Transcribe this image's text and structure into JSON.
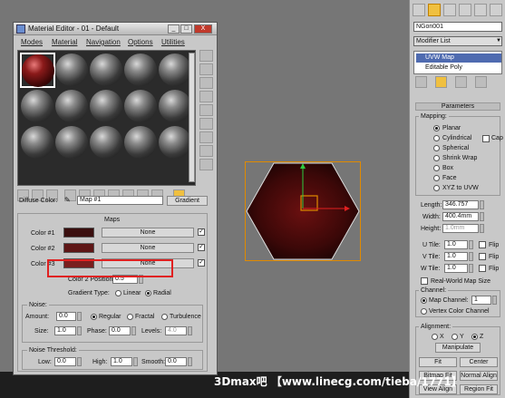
{
  "material_editor": {
    "title": "Material Editor - 01 - Default",
    "window_buttons": [
      "_",
      "□",
      "X"
    ],
    "menu": [
      "Modes",
      "Material",
      "Navigation",
      "Options",
      "Utilities"
    ],
    "diffuse_label": "Diffuse Color:",
    "map_name": "Map #1",
    "map_type_button": "Gradient",
    "maps_rollout_title": "Maps",
    "colors": [
      {
        "label": "Color #1",
        "swatch": "#3a0e0e",
        "map": "None"
      },
      {
        "label": "Color #2",
        "swatch": "#5e1616",
        "map": "None"
      },
      {
        "label": "Color #3",
        "swatch": "#7a1e1e",
        "map": "None"
      }
    ],
    "color2_position_label": "Color 2 Position:",
    "color2_position_value": "0.5",
    "gradient_type_label": "Gradient Type:",
    "gradient_type_options": [
      "Linear",
      "Radial"
    ],
    "gradient_type_selected": "Radial",
    "noise": {
      "title": "Noise:",
      "amount_label": "Amount:",
      "amount_value": "0.0",
      "types": [
        "Regular",
        "Fractal",
        "Turbulence"
      ],
      "selected_type": "Regular",
      "size_label": "Size:",
      "size_value": "1.0",
      "phase_label": "Phase:",
      "phase_value": "0.0",
      "levels_label": "Levels:",
      "levels_value": "4.0"
    },
    "noise_threshold": {
      "title": "Noise Threshold:",
      "low_label": "Low:",
      "low_value": "0.0",
      "high_label": "High:",
      "high_value": "1.0",
      "smooth_label": "Smooth:",
      "smooth_value": "0.0"
    }
  },
  "command_panel": {
    "object_name": "NGon001",
    "modifier_list_label": "Modifier List",
    "stack": [
      "UVW Map",
      "Editable Poly"
    ],
    "stack_selected": "UVW Map",
    "parameters_title": "Parameters",
    "mapping_title": "Mapping:",
    "mapping_options": [
      "Planar",
      "Cylindrical",
      "Spherical",
      "Shrink Wrap",
      "Box",
      "Face",
      "XYZ to UVW"
    ],
    "mapping_selected": "Planar",
    "cap_label": "Cap",
    "length_label": "Length:",
    "length_value": "346.757",
    "width_label": "Width:",
    "width_value": "400.4mm",
    "height_label": "Height:",
    "height_value": "1.0mm",
    "tiles": [
      {
        "label": "U Tile:",
        "value": "1.0",
        "flip": "Flip"
      },
      {
        "label": "V Tile:",
        "value": "1.0",
        "flip": "Flip"
      },
      {
        "label": "W Tile:",
        "value": "1.0",
        "flip": "Flip"
      }
    ],
    "real_world_label": "Real-World Map Size",
    "channel_title": "Channel:",
    "map_channel_label": "Map Channel:",
    "map_channel_value": "1",
    "vertex_color_label": "Vertex Color Channel",
    "alignment_title": "Alignment:",
    "axes": [
      "X",
      "Y",
      "Z"
    ],
    "axis_selected": "Z",
    "manipulate_label": "Manipulate",
    "fit_label": "Fit",
    "center_label": "Center",
    "bitmap_fit_label": "Bitmap Fit",
    "normal_align_label": "Normal Align",
    "view_align_label": "View Align",
    "region_fit_label": "Region Fit"
  },
  "watermark": "3Dmax吧 【www.linecg.com/tieba/1771】"
}
